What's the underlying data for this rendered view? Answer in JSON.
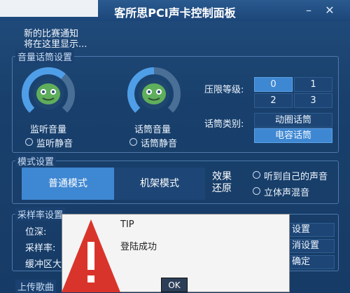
{
  "window": {
    "title": "客所思PCI声卡控制面板",
    "notice_line1": "新的比赛通知",
    "notice_line2": "将在这里显示..."
  },
  "volume_group": {
    "label": "音量话筒设置",
    "monitor": {
      "label": "监听音量",
      "mute_label": "监听静音",
      "level": 0.65
    },
    "mic": {
      "label": "话筒音量",
      "mute_label": "话筒静音",
      "level": 0.5
    },
    "limiter": {
      "label": "压限等级:",
      "options": [
        "0",
        "1",
        "2",
        "3"
      ],
      "selected": "0"
    },
    "mic_type": {
      "label": "话筒类别:",
      "options": [
        "动圈话筒",
        "电容话筒"
      ],
      "selected": "电容话筒"
    }
  },
  "mode_group": {
    "label": "模式设置",
    "normal": "普通模式",
    "rack": "机架模式",
    "effect_line1": "效果",
    "effect_line2": "还原",
    "hear_self": "听到自己的声音",
    "stereo_mix": "立体声混音"
  },
  "sample_group": {
    "label": "采样率设置",
    "bit_depth": "位深:",
    "sample_rate": "采样率:",
    "buffer": "缓冲区大",
    "set": "设置",
    "cancel_set": "消设置",
    "confirm": "确定"
  },
  "upload_label": "上传歌曲",
  "dialog": {
    "title": "TIP",
    "message": "登陆成功",
    "ok": "OK"
  },
  "colors": {
    "accent": "#3e87d2",
    "background": "#173a64",
    "warning": "#d9342b"
  }
}
